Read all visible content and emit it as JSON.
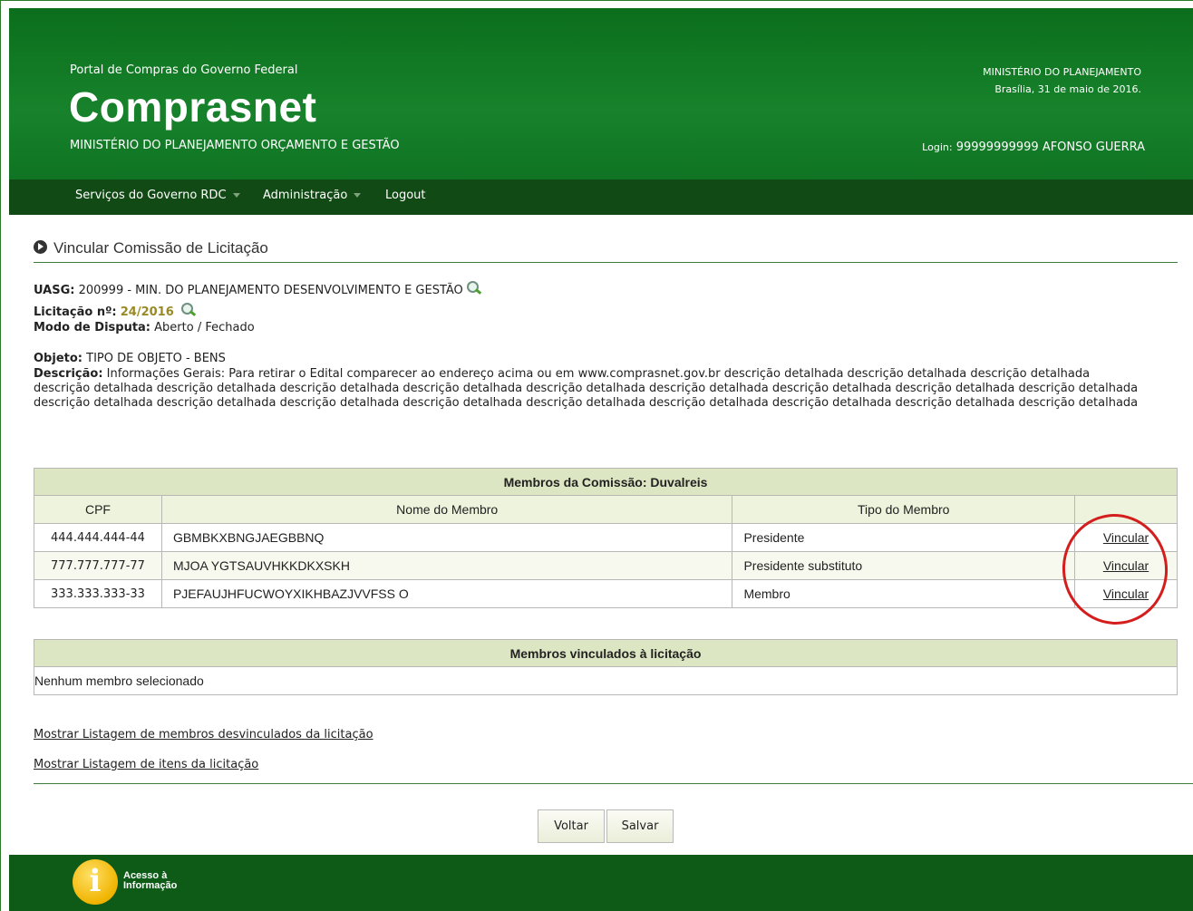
{
  "header": {
    "portal": "Portal de Compras do Governo Federal",
    "brand": "Comprasnet",
    "ministry": "MINISTÉRIO DO PLANEJAMENTO ORÇAMENTO E GESTÃO",
    "right_ministry": "MINISTÉRIO DO PLANEJAMENTO",
    "right_date": "Brasília, 31 de maio de 2016.",
    "login_label": "Login:",
    "login_value": "99999999999 AFONSO GUERRA"
  },
  "nav": {
    "items": [
      {
        "label": "Serviços do Governo RDC",
        "dropdown": true
      },
      {
        "label": "Administração",
        "dropdown": true
      },
      {
        "label": "Logout",
        "dropdown": false
      }
    ]
  },
  "page": {
    "title": "Vincular Comissão de Licitação",
    "uasg_label": "UASG:",
    "uasg_value": "200999 - MIN. DO PLANEJAMENTO DESENVOLVIMENTO E GESTÃO",
    "licitacao_label": "Licitação nº:",
    "licitacao_value": "24/2016",
    "modo_label": "Modo de Disputa:",
    "modo_value": "Aberto / Fechado",
    "objeto_label": "Objeto:",
    "objeto_value": "TIPO DE OBJETO - BENS",
    "descricao_label": "Descrição:",
    "descricao_value": "Informações Gerais: Para retirar o Edital comparecer ao endereço acima ou em www.comprasnet.gov.br descrição detalhada descrição detalhada descrição detalhada descrição detalhada descrição detalhada descrição detalhada descrição detalhada descrição detalhada descrição detalhada descrição detalhada descrição detalhada descrição detalhada descrição detalhada descrição detalhada descrição detalhada descrição detalhada descrição detalhada descrição detalhada descrição detalhada descrição detalhada descrição detalhada"
  },
  "members_table": {
    "caption": "Membros da Comissão: Duvalreis",
    "columns": [
      "CPF",
      "Nome do Membro",
      "Tipo do Membro",
      ""
    ],
    "rows": [
      {
        "cpf": "444.444.444-44",
        "nome": "GBMBKXBNGJAEGBBNQ",
        "tipo": "Presidente",
        "action": "Vincular"
      },
      {
        "cpf": "777.777.777-77",
        "nome": "MJOA YGTSAUVHKKDKXSKH",
        "tipo": "Presidente substituto",
        "action": "Vincular"
      },
      {
        "cpf": "333.333.333-33",
        "nome": "PJEFAUJHFUCWOYXIKHBAZJVVFSS O",
        "tipo": "Membro",
        "action": "Vincular"
      }
    ]
  },
  "linked_table": {
    "caption": "Membros vinculados à licitação",
    "empty_text": "Nenhum membro selecionado"
  },
  "links": {
    "unlinked": "Mostrar Listagem de membros desvinculados da licitação",
    "items": "Mostrar Listagem de itens da licitação"
  },
  "buttons": {
    "back": "Voltar",
    "save": "Salvar"
  },
  "footer": {
    "logo_letter": "i",
    "logo_line1": "Acesso à",
    "logo_line2": "Informação"
  },
  "colors": {
    "header_green": "#17822b",
    "nav_green": "#114a14",
    "footer_green": "#0e5b18",
    "table_caption": "#dde6c2",
    "highlight_ring": "#d41e1e"
  }
}
